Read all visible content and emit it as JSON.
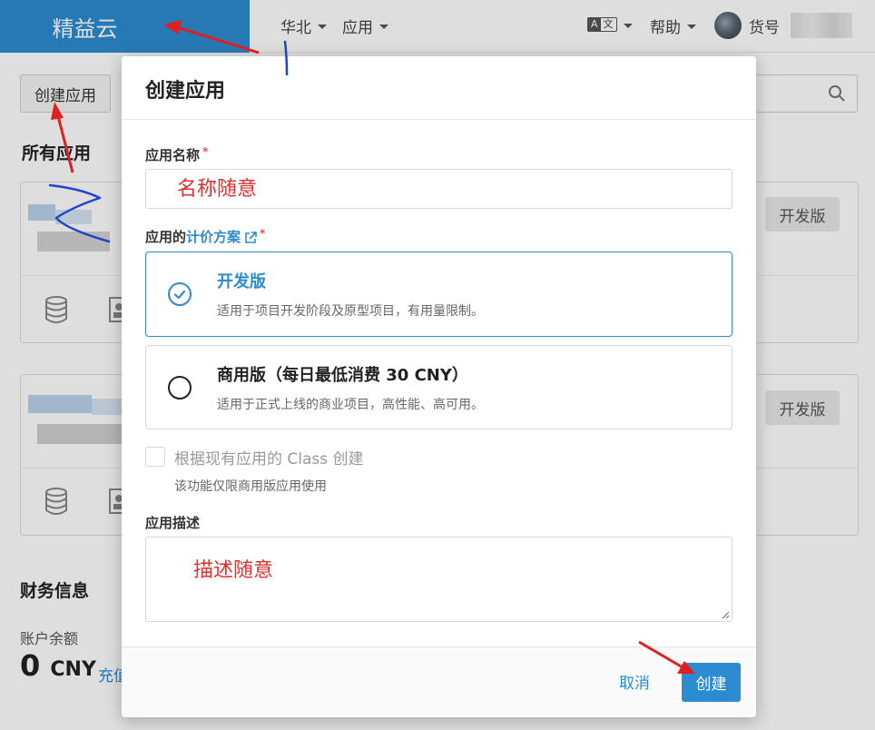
{
  "topbar": {
    "brand": "精益云",
    "region": "华北",
    "apps_menu": "应用",
    "language_icon": "lang-icon",
    "help": "帮助",
    "user_label": "货号",
    "brand_color": "#2d8bd2"
  },
  "page": {
    "create_button": "创建应用",
    "all_apps_title": "所有应用",
    "dev_badge": "开发版",
    "finance_title": "财务信息",
    "balance_label": "账户余额",
    "balance_amount": "0",
    "balance_unit": "CNY",
    "recharge": "充值"
  },
  "modal": {
    "title": "创建应用",
    "name_label": "应用名称",
    "required_mark": "*",
    "plan_label_prefix": "应用的",
    "plan_label_link": "计价方案",
    "plans": [
      {
        "name": "开发版",
        "desc": "适用于项目开发阶段及原型项目，有用量限制。",
        "selected": true
      },
      {
        "name": "商用版（每日最低消费 30 CNY）",
        "desc": "适用于正式上线的商业项目，高性能、高可用。",
        "selected": false
      }
    ],
    "class_checkbox_label": "根据现有应用的 Class 创建",
    "class_checkbox_hint": "该功能仅限商用版应用使用",
    "desc_label": "应用描述",
    "cancel": "取消",
    "submit": "创建"
  },
  "annotations": {
    "name_hint": "名称随意",
    "desc_hint": "描述随意"
  },
  "colors": {
    "primary": "#2d8bd2",
    "annotation_red": "#e03030",
    "annotation_blue": "#2244cc"
  }
}
